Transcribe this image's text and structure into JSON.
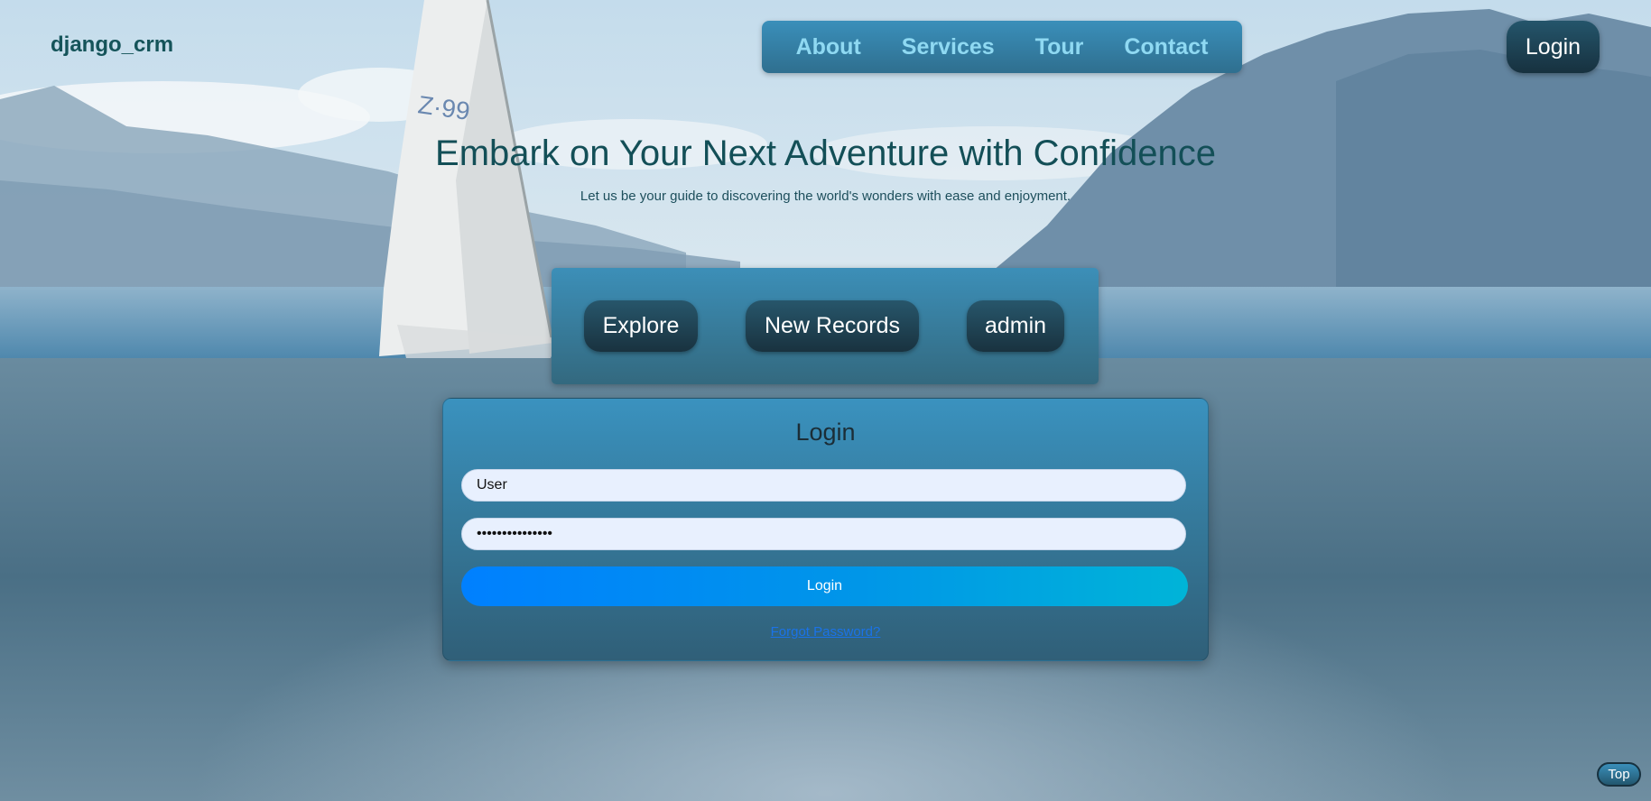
{
  "brand": "django_crm",
  "nav": {
    "links": [
      "About",
      "Services",
      "Tour",
      "Contact"
    ],
    "login_label": "Login"
  },
  "hero": {
    "title": "Embark on Your Next Adventure with Confidence",
    "subtitle": "Let us be your guide to discovering the world's wonders with ease and enjoyment."
  },
  "actions": [
    "Explore",
    "New Records",
    "admin"
  ],
  "login_form": {
    "title": "Login",
    "username_value": "User",
    "password_value": "•••••••••••••••",
    "submit_label": "Login",
    "forgot_label": "Forgot Password?"
  },
  "top_button": "Top",
  "colors": {
    "brand_text": "#15545a",
    "nav_link": "#8fd9f2",
    "panel": "#3a8fba",
    "pill": "#19323f",
    "submit_start": "#0080ff",
    "submit_end": "#00b4d8"
  }
}
